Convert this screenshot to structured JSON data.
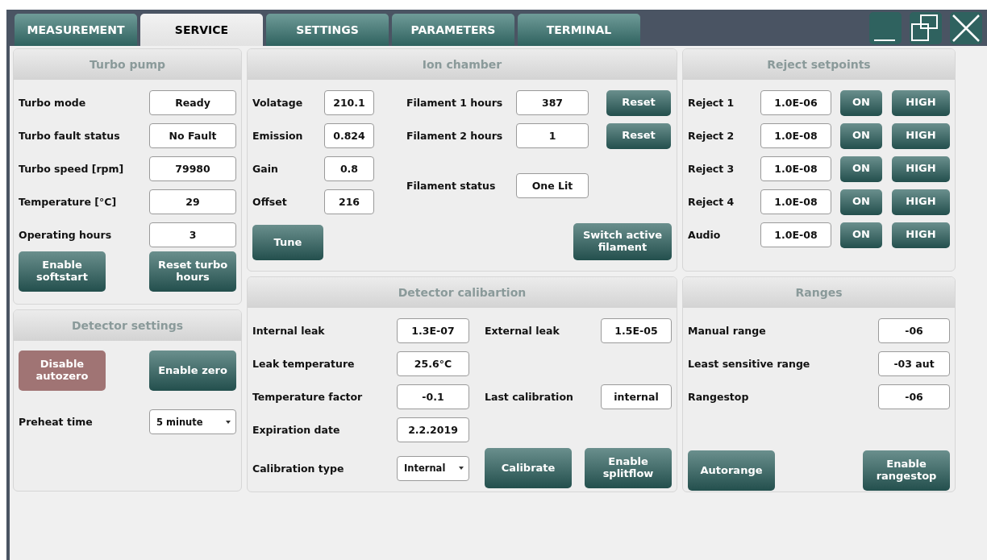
{
  "tabs": [
    {
      "label": "MEASUREMENT",
      "selected": false
    },
    {
      "label": "SERVICE",
      "selected": true
    },
    {
      "label": "SETTINGS",
      "selected": false
    },
    {
      "label": "PARAMETERS",
      "selected": false
    },
    {
      "label": "TERMINAL",
      "selected": false
    }
  ],
  "turbo_pump": {
    "title": "Turbo pump",
    "fields": [
      {
        "label": "Turbo mode",
        "value": "Ready"
      },
      {
        "label": "Turbo fault status",
        "value": "No Fault"
      },
      {
        "label": "Turbo speed [rpm]",
        "value": "79980"
      },
      {
        "label": "Temperature [°C]",
        "value": "29"
      },
      {
        "label": "Operating hours",
        "value": "3"
      }
    ],
    "buttons": [
      {
        "label": "Enable softstart",
        "kind": "teal"
      },
      {
        "label": "Reset turbo hours",
        "kind": "teal"
      }
    ]
  },
  "ion_chamber": {
    "title": "Ion chamber",
    "fields": [
      {
        "label": "Volatage",
        "value": "210.1"
      },
      {
        "label": "Emission",
        "value": "0.824"
      },
      {
        "label": "Gain",
        "value": "0.8"
      },
      {
        "label": "Offset",
        "value": "216"
      }
    ],
    "filaments": [
      {
        "label": "Filament 1 hours",
        "value": "387",
        "button": {
          "label": "Reset",
          "kind": "teal"
        }
      },
      {
        "label": "Filament 2 hours",
        "value": "1",
        "button": {
          "label": "Reset",
          "kind": "teal"
        }
      }
    ],
    "filament_status": {
      "label": "Filament status",
      "value": "One Lit"
    },
    "buttons": [
      {
        "label": "Tune",
        "kind": "teal"
      },
      {
        "label": "Switch active filament",
        "kind": "teal"
      }
    ]
  },
  "reject_setpoints": {
    "title": "Reject setpoints",
    "rows": [
      {
        "label": "Reject 1",
        "value": "1.0E-06",
        "state": "ON",
        "level": "HIGH"
      },
      {
        "label": "Reject 2",
        "value": "1.0E-08",
        "state": "ON",
        "level": "HIGH"
      },
      {
        "label": "Reject 3",
        "value": "1.0E-08",
        "state": "ON",
        "level": "HIGH"
      },
      {
        "label": "Reject 4",
        "value": "1.0E-08",
        "state": "ON",
        "level": "HIGH"
      },
      {
        "label": "Audio",
        "value": "1.0E-08",
        "state": "ON",
        "level": "HIGH"
      }
    ]
  },
  "detector_settings": {
    "title": "Detector settings",
    "buttons": [
      {
        "label": "Disable autozero",
        "kind": "rose"
      },
      {
        "label": "Enable zero",
        "kind": "teal"
      }
    ],
    "preheat_time": {
      "label": "Preheat time",
      "value": "5 minute"
    }
  },
  "detector_calibration": {
    "title": "Detector calibartion",
    "left_fields": [
      {
        "label": "Internal leak",
        "value": "1.3E-07"
      },
      {
        "label": "Leak temperature",
        "value": "25.6°C"
      },
      {
        "label": "Temperature factor",
        "value": "-0.1"
      },
      {
        "label": "Expiration date",
        "value": "2.2.2019"
      }
    ],
    "external_leak": {
      "label": "External leak",
      "value": "1.5E-05"
    },
    "last_calibration": {
      "label": "Last calibration",
      "value": "internal"
    },
    "calibration_type": {
      "label": "Calibration type",
      "value": "Internal"
    },
    "buttons": [
      {
        "label": "Calibrate",
        "kind": "teal"
      },
      {
        "label": "Enable splitflow",
        "kind": "teal"
      }
    ]
  },
  "ranges": {
    "title": "Ranges",
    "fields": [
      {
        "label": "Manual range",
        "value": "-06"
      },
      {
        "label": "Least sensitive range",
        "value": "-03 aut"
      },
      {
        "label": "Rangestop",
        "value": "-06"
      }
    ],
    "buttons": [
      {
        "label": "Autorange",
        "kind": "teal"
      },
      {
        "label": "Enable rangestop",
        "kind": "teal"
      }
    ]
  }
}
